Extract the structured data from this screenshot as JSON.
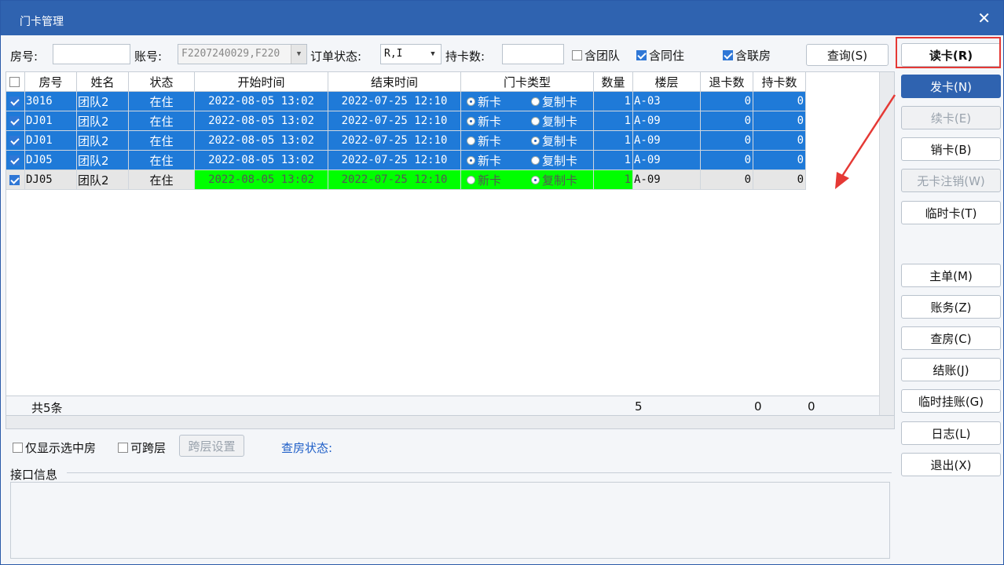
{
  "window": {
    "title": "门卡管理"
  },
  "filter": {
    "room_label": "房号:",
    "room_value": "",
    "account_label": "账号:",
    "account_value": "F2207240029,F220",
    "order_status_label": "订单状态:",
    "order_status_value": "R,I",
    "card_count_label": "持卡数:",
    "card_count_value": "",
    "include_group": "含团队",
    "include_cohabit": "含同住",
    "include_linked": "含联房",
    "query_button": "查询(S)"
  },
  "table": {
    "columns": [
      "房号",
      "姓名",
      "状态",
      "开始时间",
      "结束时间",
      "门卡类型",
      "数量",
      "楼层",
      "退卡数",
      "持卡数"
    ],
    "rows": [
      {
        "room": "3016",
        "name": "团队2",
        "status": "在住",
        "start": "2022-08-05 13:02",
        "end": "2022-07-25 12:10",
        "type_new": "新卡",
        "type_copy": "复制卡",
        "new_selected": true,
        "count": "1",
        "floor": "A-03",
        "returned": "0",
        "held": "0",
        "checked": true
      },
      {
        "room": "DJ01",
        "name": "团队2",
        "status": "在住",
        "start": "2022-08-05 13:02",
        "end": "2022-07-25 12:10",
        "type_new": "新卡",
        "type_copy": "复制卡",
        "new_selected": true,
        "count": "1",
        "floor": "A-09",
        "returned": "0",
        "held": "0",
        "checked": true
      },
      {
        "room": "DJ01",
        "name": "团队2",
        "status": "在住",
        "start": "2022-08-05 13:02",
        "end": "2022-07-25 12:10",
        "type_new": "新卡",
        "type_copy": "复制卡",
        "new_selected": false,
        "count": "1",
        "floor": "A-09",
        "returned": "0",
        "held": "0",
        "checked": true
      },
      {
        "room": "DJ05",
        "name": "团队2",
        "status": "在住",
        "start": "2022-08-05 13:02",
        "end": "2022-07-25 12:10",
        "type_new": "新卡",
        "type_copy": "复制卡",
        "new_selected": true,
        "count": "1",
        "floor": "A-09",
        "returned": "0",
        "held": "0",
        "checked": true
      },
      {
        "room": "DJ05",
        "name": "团队2",
        "status": "在住",
        "start": "2022-08-05 13:02",
        "end": "2022-07-25 12:10",
        "type_new": "新卡",
        "type_copy": "复制卡",
        "new_selected": false,
        "count": "1",
        "floor": "A-09",
        "returned": "0",
        "held": "0",
        "checked": true
      }
    ],
    "footer": {
      "total": "共5条",
      "count_sum": "5",
      "returned_sum": "0",
      "held_sum": "0"
    }
  },
  "options": {
    "only_selected": "仅显示选中房",
    "cross_floor": "可跨层",
    "cross_floor_button": "跨层设置",
    "checkout_status": "查房状态:",
    "interface_info": "接口信息"
  },
  "sidebar": {
    "read_card": "读卡(R)",
    "issue_card": "发卡(N)",
    "renew_card": "续卡(E)",
    "cancel_card": "销卡(B)",
    "cardless_cancel": "无卡注销(W)",
    "temp_card": "临时卡(T)",
    "master": "主单(M)",
    "accounts": "账务(Z)",
    "check_room": "查房(C)",
    "checkout": "结账(J)",
    "temp_hang": "临时挂账(G)",
    "log": "日志(L)",
    "exit": "退出(X)"
  },
  "colors": {
    "title_bar": "#2f63b0",
    "selected_row": "#1f7ad8",
    "current_highlight": "#00ff00",
    "annotation": "#e53935"
  }
}
